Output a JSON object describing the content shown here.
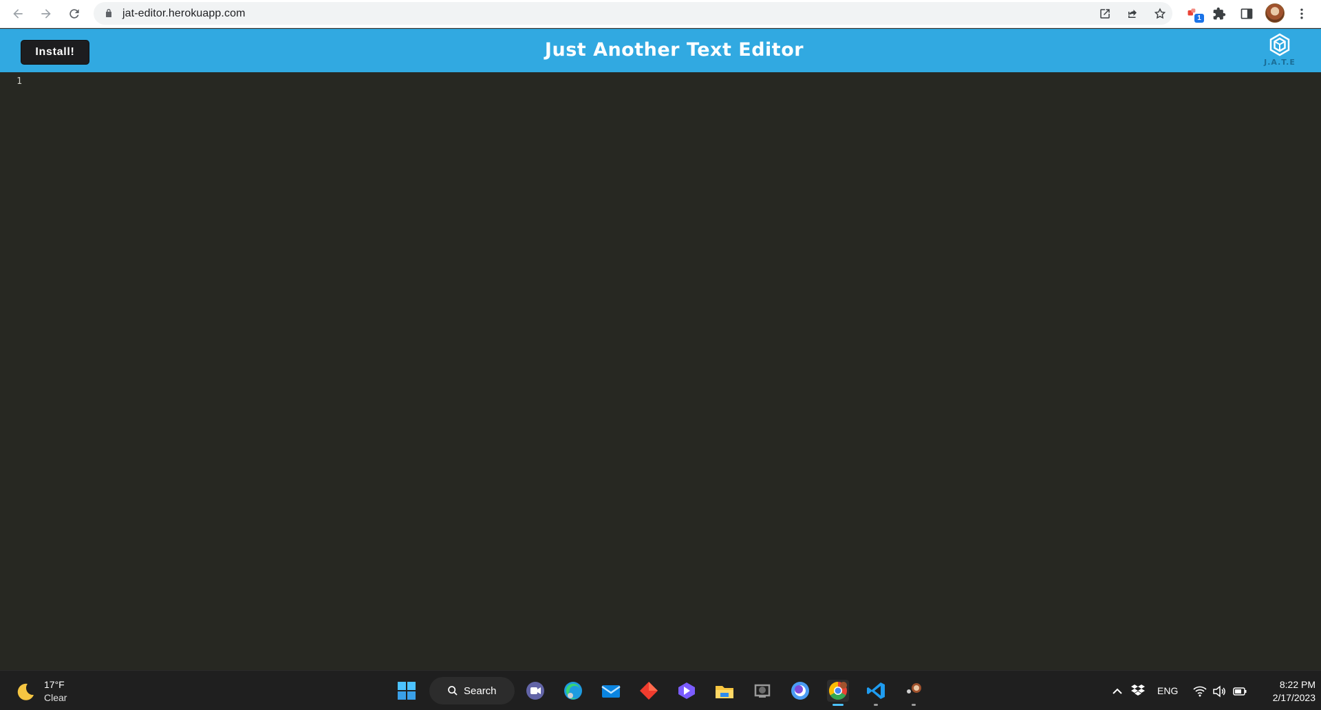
{
  "browser": {
    "url": "jat-editor.herokuapp.com",
    "extension_badge": "1"
  },
  "app": {
    "install_label": "Install!",
    "title": "Just Another Text Editor",
    "logo_text": "J.A.T.E",
    "brand_color": "#31a9e1"
  },
  "editor": {
    "line_numbers": [
      "1"
    ],
    "content": "",
    "background": "#272822"
  },
  "taskbar": {
    "weather": {
      "temp": "17°F",
      "condition": "Clear"
    },
    "search_label": "Search",
    "language": "ENG",
    "time": "8:22 PM",
    "date": "2/17/2023",
    "apps": [
      "start-icon",
      "teams-icon",
      "edge-icon",
      "mail-icon",
      "git-icon",
      "copilot-icon",
      "file-explorer-icon",
      "github-desktop-icon",
      "insomnia-icon",
      "chrome-icon",
      "vscode-icon",
      "app-icon"
    ]
  }
}
